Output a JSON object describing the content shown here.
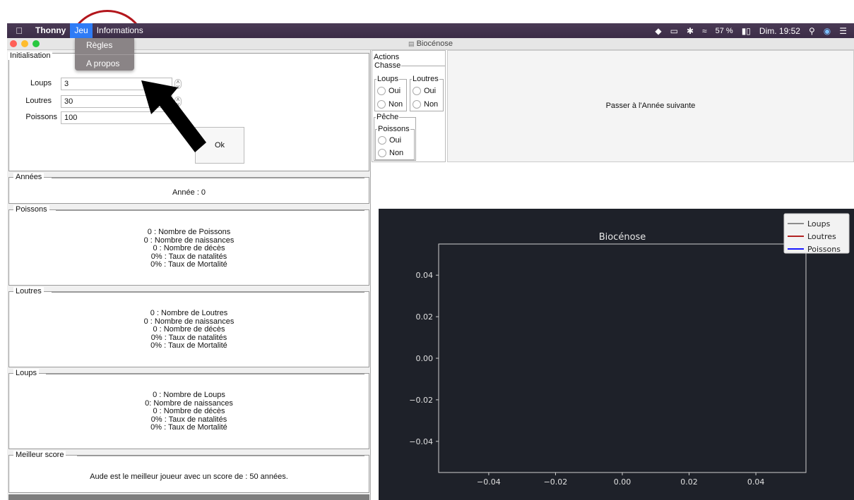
{
  "menubar": {
    "app": "Thonny",
    "items": [
      "Jeu",
      "Informations"
    ],
    "status": {
      "battery": "57 %",
      "datetime": "Dim. 19:52"
    }
  },
  "window": {
    "title": "Biocénose"
  },
  "dropdown": {
    "items": [
      "Règles",
      "A propos"
    ]
  },
  "init": {
    "title": "Initialisation",
    "fields": [
      {
        "label": "Loups",
        "value": "3"
      },
      {
        "label": "Loutres",
        "value": "30"
      },
      {
        "label": "Poissons",
        "value": "100"
      }
    ],
    "ok_label": "Ok"
  },
  "annees": {
    "title": "Années",
    "text": "Année : 0"
  },
  "poissons": {
    "title": "Poissons",
    "lines": [
      "0 : Nombre de Poissons",
      "0 : Nombre de naissances",
      "0 : Nombre de décès",
      "0% : Taux de natalités",
      "0% : Taux de Mortalité"
    ]
  },
  "loutres": {
    "title": "Loutres",
    "lines": [
      "0 : Nombre de Loutres",
      "0 : Nombre de naissances",
      "0 : Nombre de décès",
      "0% : Taux de natalités",
      "0% : Taux de Mortalité"
    ]
  },
  "loups": {
    "title": "Loups",
    "lines": [
      "0 : Nombre de Loups",
      "0: Nombre de naissances",
      "0 : Nombre de décès",
      "0% : Taux de natalités",
      "0% : Taux de Mortalité"
    ]
  },
  "score": {
    "title": "Meilleur score",
    "text": "Aude est le meilleur joueur avec un score de : 50 années."
  },
  "actions": {
    "title": "Actions",
    "chasse": "Chasse",
    "loups": "Loups",
    "loutres": "Loutres",
    "peche": "Pêche",
    "poissons": "Poissons",
    "oui": "Oui",
    "non": "Non"
  },
  "next_button": "Passer à l'Année suivante",
  "chart_data": {
    "type": "line",
    "title": "Biocénose",
    "xlim": [
      -0.055,
      0.055
    ],
    "ylim": [
      -0.055,
      0.055
    ],
    "xticks": [
      "−0.04",
      "−0.02",
      "0.00",
      "0.02",
      "0.04"
    ],
    "yticks": [
      "0.04",
      "0.02",
      "0.00",
      "−0.02",
      "−0.04"
    ],
    "series": [
      {
        "name": "Loups",
        "color": "#8c8c8c",
        "values": []
      },
      {
        "name": "Loutres",
        "color": "#b22222",
        "values": []
      },
      {
        "name": "Poissons",
        "color": "#1a1aff",
        "values": []
      }
    ],
    "legend": "top-right"
  }
}
